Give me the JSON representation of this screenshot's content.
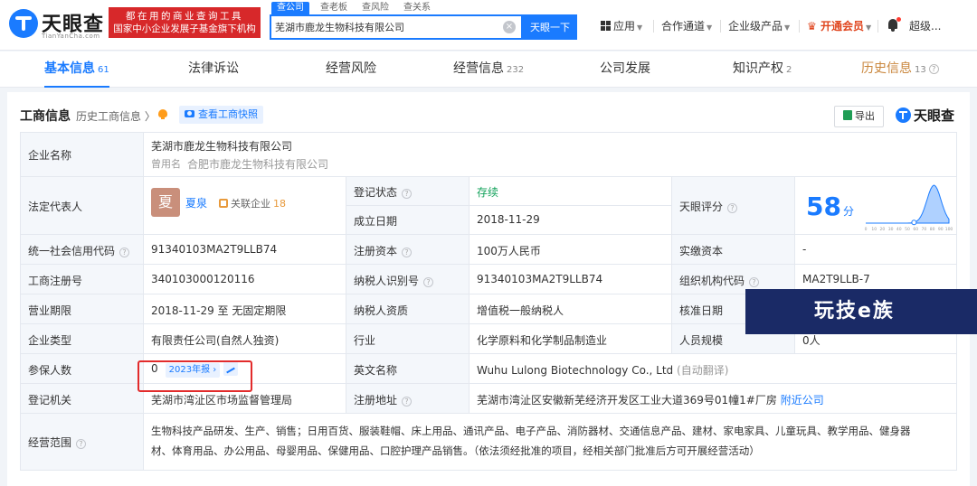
{
  "header": {
    "logo_text": "天眼查",
    "logo_sub": "TianYanCha.com",
    "slogan_line1": "都在用的商业查询工具",
    "slogan_line2": "国家中小企业发展子基金旗下机构",
    "search_tabs": [
      "查公司",
      "查老板",
      "查风险",
      "查关系"
    ],
    "search_value": "芜湖市鹿龙生物科技有限公司",
    "search_button": "天眼一下",
    "nav": [
      "应用",
      "合作通道",
      "企业级产品",
      "开通会员",
      "超级..."
    ]
  },
  "tabs": [
    {
      "label": "基本信息",
      "count": "61"
    },
    {
      "label": "法律诉讼",
      "count": ""
    },
    {
      "label": "经营风险",
      "count": ""
    },
    {
      "label": "经营信息",
      "count": "232"
    },
    {
      "label": "公司发展",
      "count": ""
    },
    {
      "label": "知识产权",
      "count": "2"
    },
    {
      "label": "历史信息",
      "count": "13"
    }
  ],
  "card": {
    "title": "工商信息",
    "history_link": "历史工商信息 〉",
    "snapshot_button": "查看工商快照",
    "export_button": "导出",
    "brand": "天眼查"
  },
  "labels": {
    "company_name": "企业名称",
    "legal_rep": "法定代表人",
    "reg_status": "登记状态",
    "found_date": "成立日期",
    "score": "天眼评分",
    "credit_code": "统一社会信用代码",
    "reg_capital": "注册资本",
    "paid_capital": "实缴资本",
    "reg_number": "工商注册号",
    "taxpayer_id": "纳税人识别号",
    "org_code": "组织机构代码",
    "term": "营业期限",
    "taxpayer_type": "纳税人资质",
    "approval_date": "核准日期",
    "company_type": "企业类型",
    "industry": "行业",
    "staff_size": "人员规模",
    "insured": "参保人数",
    "english_name": "英文名称",
    "authority": "登记机关",
    "address": "注册地址",
    "scope": "经营范围"
  },
  "values": {
    "company_name": "芜湖市鹿龙生物科技有限公司",
    "former_name_label": "曾用名",
    "former_name": "合肥市鹿龙生物科技有限公司",
    "avatar_char": "夏",
    "legal_rep": "夏泉",
    "related_label": "关联企业",
    "related_count": "18",
    "reg_status": "存续",
    "found_date": "2018-11-29",
    "score": "58",
    "score_unit": "分",
    "credit_code": "91340103MA2T9LLB74",
    "reg_capital": "100万人民币",
    "paid_capital": "-",
    "reg_number": "340103000120116",
    "taxpayer_id": "91340103MA2T9LLB74",
    "org_code": "MA2T9LLB-7",
    "term": "2018-11-29 至 无固定期限",
    "taxpayer_type": "增值税一般纳税人",
    "approval_date": "",
    "company_type": "有限责任公司(自然人独资)",
    "industry": "化学原料和化学制品制造业",
    "staff_size": "0人",
    "insured": "0",
    "insured_report": "2023年报",
    "english_name": "Wuhu Lulong Biotechnology Co., Ltd",
    "english_note": "(自动翻译)",
    "authority": "芜湖市湾沚区市场监督管理局",
    "address": "芜湖市湾沚区安徽新芜经济开发区工业大道369号01幢1#厂房",
    "address_link": "附近公司",
    "scope_line1": "生物科技产品研发、生产、销售；日用百货、服装鞋帽、床上用品、通讯产品、电子产品、消防器材、交通信息产品、建材、家电家具、儿童玩具、教学用品、健身器",
    "scope_line2": "材、体育用品、办公用品、母婴用品、保健用品、口腔护理产品销售。（依法须经批准的项目，经相关部门批准后方可开展经营活动）"
  },
  "score_chart": {
    "type": "area",
    "x_ticks": [
      "0",
      "10",
      "20",
      "30",
      "40",
      "50",
      "60",
      "70",
      "80",
      "90",
      "100"
    ],
    "marker_x": 58
  },
  "watermark": "玩技e族",
  "colors": {
    "accent": "#1a7bff",
    "status_green": "#13a25b",
    "slogan_red": "#d7282a",
    "highlight_box": "#e22b2b"
  }
}
